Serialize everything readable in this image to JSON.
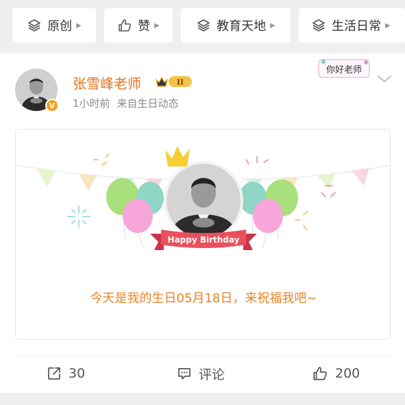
{
  "tabs": [
    {
      "label": "原创",
      "icon": "layers-icon"
    },
    {
      "label": "赞",
      "icon": "thumb-up-icon"
    },
    {
      "label": "教育天地",
      "icon": "layers-icon"
    },
    {
      "label": "生活日常",
      "icon": "layers-icon"
    }
  ],
  "post": {
    "author": "张雪峰老师",
    "level_badge": "II",
    "time": "1小时前",
    "source": "来自生日动态",
    "sticker_text": "你好老师",
    "verified_mark": "V"
  },
  "birthday": {
    "ribbon": "Happy Birthday",
    "greeting": "今天是我的生日05月18日，来祝福我吧~"
  },
  "actions": {
    "repost_count": "30",
    "comment_label": "评论",
    "like_count": "200"
  },
  "colors": {
    "accent_orange": "#e8731c",
    "ribbon_red": "#e9505c",
    "page_bg": "#efefef"
  }
}
